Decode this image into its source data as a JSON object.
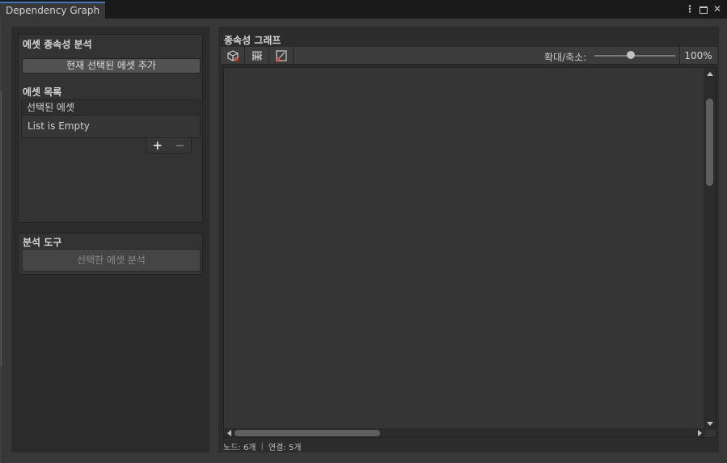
{
  "window": {
    "tab_title": "Dependency Graph",
    "controls": {
      "menu_icon": "kebab-icon",
      "maximize_icon": "maximize-icon",
      "close_icon": "close-icon"
    }
  },
  "left": {
    "analysis_section": {
      "title": "에셋 종속성 분석",
      "add_button": "현재 선택된 에셋 추가",
      "asset_list_label": "에셋 목록",
      "list_header": "선택된 에셋",
      "list_empty": "List is Empty",
      "add_item": "+",
      "remove_item": "−"
    },
    "tools_section": {
      "title": "분석 도구",
      "analyze_button": "선택한 에셋 분석"
    }
  },
  "right": {
    "title": "종속성 그래프",
    "toolbar": {
      "tool_icons": [
        "cube-icon",
        "hierarchy-icon",
        "frame-icon"
      ],
      "zoom_label": "확대/축소:",
      "zoom_fraction": 0.45,
      "zoom_value": "100%"
    },
    "status": {
      "nodes": "노드: 6개",
      "separator": "|",
      "links": "연결: 5개"
    }
  }
}
